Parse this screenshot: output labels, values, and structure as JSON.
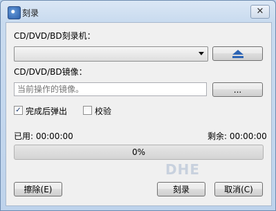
{
  "window": {
    "title": "刻录",
    "close_glyph": "✕"
  },
  "drive": {
    "label": "CD/DVD/BD刻录机：",
    "selected": ""
  },
  "eject": {
    "icon": "eject-icon"
  },
  "image": {
    "label": "CD/DVD/BD镜像：",
    "placeholder": "当前操作的镜像。",
    "browse_label": "..."
  },
  "options": {
    "eject_after": {
      "label": "完成后弹出",
      "checked": true,
      "mark": "✓"
    },
    "verify": {
      "label": "校验",
      "checked": false
    }
  },
  "status": {
    "used": "已用: 00:00:00",
    "remaining": "剩余: 00:00:00",
    "progress_text": "0%",
    "progress_value": 0
  },
  "buttons": {
    "erase": "擦除(E)",
    "burn": "刻录",
    "cancel": "取消(C)"
  },
  "watermark": "DHE"
}
